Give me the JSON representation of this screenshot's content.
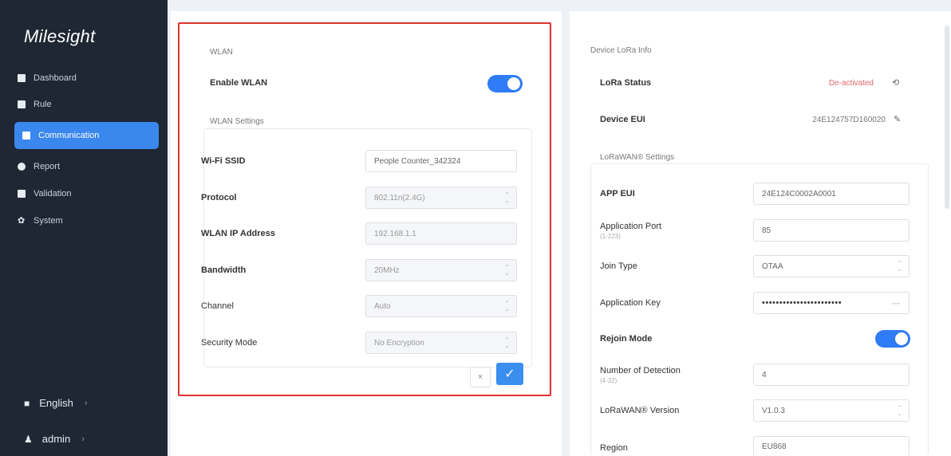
{
  "app": {
    "logo": "Milesight"
  },
  "sidebar": {
    "items": [
      {
        "label": "Dashboard",
        "icon": "dashboard-icon"
      },
      {
        "label": "Rule",
        "icon": "rule-icon"
      },
      {
        "label": "Communication",
        "icon": "communication-icon",
        "active": true
      },
      {
        "label": "Report",
        "icon": "report-icon"
      },
      {
        "label": "Validation",
        "icon": "validation-icon"
      },
      {
        "label": "System",
        "icon": "gear-icon"
      }
    ],
    "language": "English",
    "user": "admin"
  },
  "wlan": {
    "section_title": "WLAN",
    "enable_label": "Enable WLAN",
    "enable_on": true,
    "settings_title": "WLAN Settings",
    "rows": [
      {
        "label": "Wi-Fi SSID",
        "value": "People Counter_342324"
      },
      {
        "label": "Protocol",
        "value": "802.11n(2.4G)"
      },
      {
        "label": "WLAN IP Address",
        "value": "192.168.1.1"
      },
      {
        "label": "Bandwidth",
        "value": "20MHz"
      },
      {
        "label": "Channel",
        "value": "Auto"
      },
      {
        "label": "Security Mode",
        "value": "No Encryption"
      }
    ],
    "cancel_glyph": "×",
    "confirm_glyph": "✓"
  },
  "lora": {
    "info_title": "Device LoRa Info",
    "status_label": "LoRa Status",
    "status_value": "De-activated",
    "device_eui_label": "Device EUI",
    "device_eui_value": "24E124757D160020",
    "settings_title": "LoRaWAN® Settings",
    "rows": [
      {
        "label": "APP EUI",
        "value": "24E124C0002A0001"
      },
      {
        "label": "Application Port",
        "sublabel": "(1-223)",
        "value": "85"
      },
      {
        "label": "Join Type",
        "value": "OTAA"
      },
      {
        "label": "Application Key",
        "value": "•••••••••••••••••••••••"
      },
      {
        "label": "Rejoin Mode",
        "toggle": true
      },
      {
        "label": "Number of Detection",
        "sublabel": "(4-32)",
        "value": "4"
      },
      {
        "label": "LoRaWAN® Version",
        "value": "V1.0.3"
      },
      {
        "label": "Region",
        "value": "EU868"
      }
    ]
  },
  "colors": {
    "accent": "#2f7cf6",
    "sidebar": "#1f2734",
    "highlight": "#e03131"
  }
}
